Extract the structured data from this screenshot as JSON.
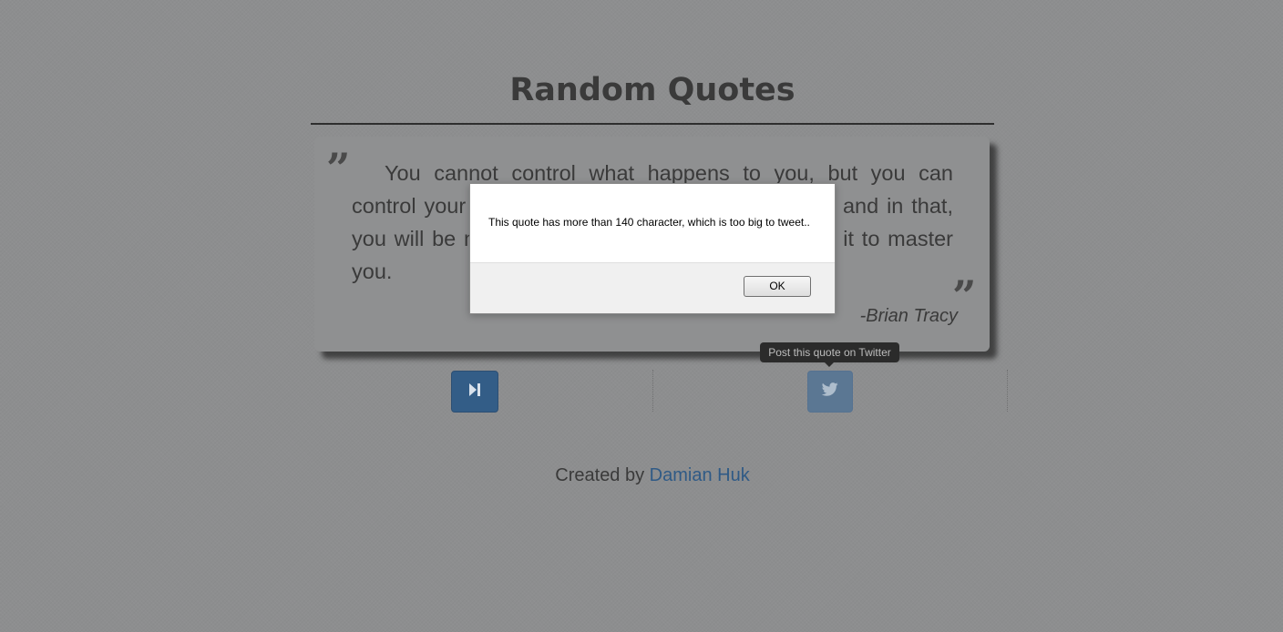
{
  "header": {
    "title": "Random Quotes"
  },
  "quote": {
    "text": "You cannot control what happens to you, but you can control your attitude toward what happens to you, and in that, you will be mastering change rather than allowing it to master you.",
    "author": "-Brian Tracy",
    "open_mark": "”",
    "close_mark": "”"
  },
  "buttons": {
    "next_icon": "step-forward-icon",
    "tweet_icon": "twitter-bird-icon"
  },
  "tooltip": {
    "text": "Post this quote on Twitter"
  },
  "footer": {
    "prefix": "Created by ",
    "author_link": "Damian Huk"
  },
  "dialog": {
    "message": "This quote has more than 140 character, which is too big to tweet..",
    "ok_label": "OK"
  },
  "colors": {
    "background": "#8d8e8f",
    "accent_button": "#335d87",
    "link": "#2f5a86",
    "text": "#3a3a3a"
  }
}
